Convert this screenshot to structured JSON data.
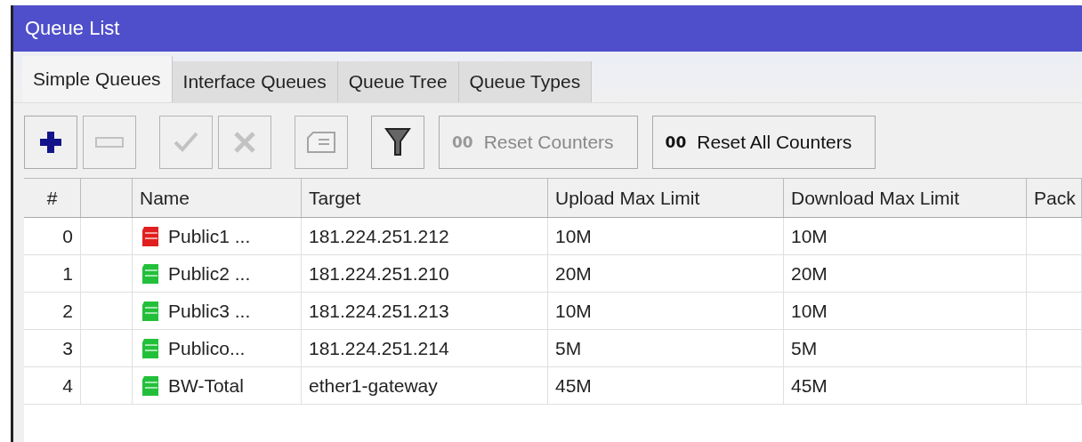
{
  "window": {
    "title": "Queue List"
  },
  "tabs": [
    {
      "label": "Simple Queues",
      "selected": true
    },
    {
      "label": "Interface Queues",
      "selected": false
    },
    {
      "label": "Queue Tree",
      "selected": false
    },
    {
      "label": "Queue Types",
      "selected": false
    }
  ],
  "toolbar": [
    {
      "kind": "add",
      "disabled": false
    },
    {
      "kind": "remove",
      "disabled": true
    },
    {
      "kind": "enable",
      "disabled": true
    },
    {
      "kind": "disable",
      "disabled": true
    },
    {
      "kind": "comment",
      "disabled": true
    },
    {
      "kind": "filter",
      "disabled": false
    },
    {
      "kind": "text",
      "badge": "00",
      "label": "Reset Counters",
      "disabled": true
    },
    {
      "kind": "text",
      "badge": "00",
      "label": "Reset All Counters",
      "disabled": false
    }
  ],
  "table": {
    "columns": [
      "#",
      "",
      "Name",
      "Target",
      "Upload Max Limit",
      "Download Max Limit",
      "Pack"
    ],
    "rows": [
      {
        "index": "0",
        "name": "Public1 ...",
        "color": "#e02020",
        "target": "181.224.251.212",
        "upload": "10M",
        "download": "10M"
      },
      {
        "index": "1",
        "name": "Public2 ...",
        "color": "#22c03a",
        "target": "181.224.251.210",
        "upload": "20M",
        "download": "20M"
      },
      {
        "index": "2",
        "name": "Public3 ...",
        "color": "#22c03a",
        "target": "181.224.251.213",
        "upload": "10M",
        "download": "10M"
      },
      {
        "index": "3",
        "name": "Publico...",
        "color": "#22c03a",
        "target": "181.224.251.214",
        "upload": "5M",
        "download": "5M"
      },
      {
        "index": "4",
        "name": "BW-Total",
        "color": "#22c03a",
        "target": "ether1-gateway",
        "upload": "45M",
        "download": "45M"
      }
    ]
  }
}
